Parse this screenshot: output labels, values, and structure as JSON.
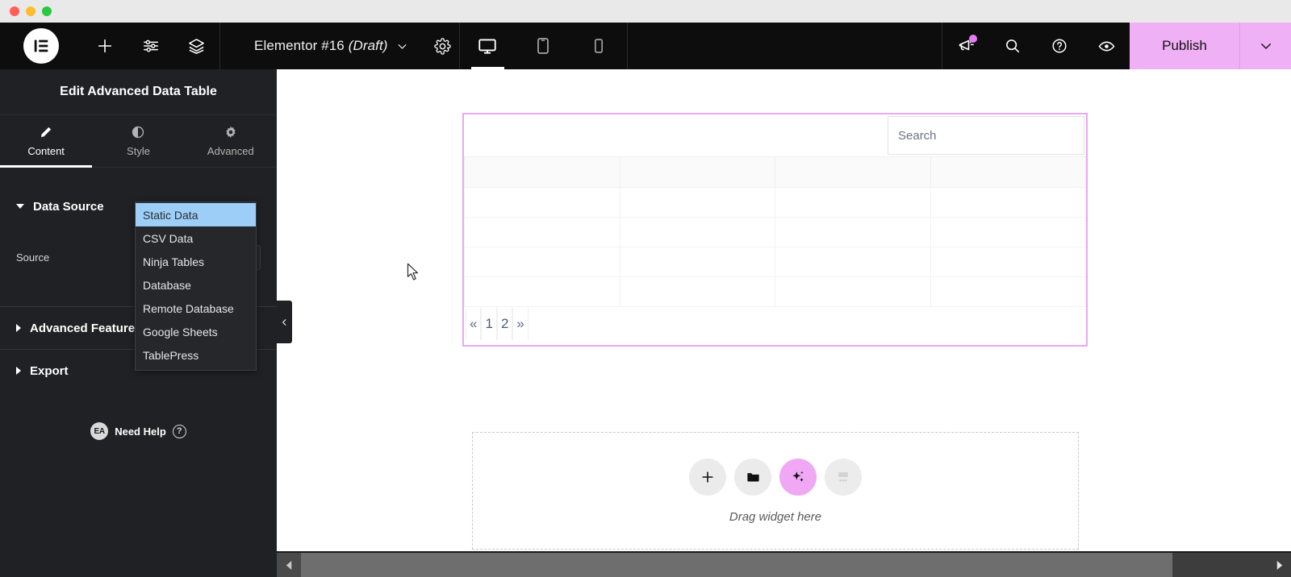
{
  "window": {
    "traffic_lights": [
      "close",
      "minimize",
      "zoom"
    ]
  },
  "topbar": {
    "logo_name": "elementor-logo",
    "add_label": "+",
    "icons": [
      "elementor-logo",
      "add-element-icon",
      "settings-sliders-icon",
      "layers-icon"
    ],
    "document_title": "Elementor #16",
    "document_state": "(Draft)",
    "settings_icon": "gear-icon",
    "devices": [
      {
        "name": "desktop",
        "label": "Desktop",
        "active": true
      },
      {
        "name": "tablet",
        "label": "Tablet",
        "active": false
      },
      {
        "name": "mobile",
        "label": "Mobile",
        "active": false
      }
    ],
    "right_icons": [
      {
        "name": "whats-new-megaphone-icon",
        "badge": true
      },
      {
        "name": "search-icon",
        "badge": false
      },
      {
        "name": "help-icon",
        "badge": false
      },
      {
        "name": "preview-eye-icon",
        "badge": false
      }
    ],
    "publish_label": "Publish",
    "publish_color": "#f0b0f5",
    "publish_caret_icon": "chevron-down-icon"
  },
  "panel": {
    "title": "Edit Advanced Data Table",
    "tabs": [
      {
        "label": "Content",
        "icon": "pencil-icon",
        "active": true
      },
      {
        "label": "Style",
        "icon": "contrast-circle-icon",
        "active": false
      },
      {
        "label": "Advanced",
        "icon": "gear-icon",
        "active": false
      }
    ],
    "sections": [
      {
        "label": "Data Source",
        "expanded": true
      },
      {
        "label": "Advanced Features",
        "expanded": false
      },
      {
        "label": "Export",
        "expanded": false
      }
    ],
    "source_control": {
      "label": "Source",
      "value": "Static Data",
      "options": [
        "Static Data",
        "CSV Data",
        "Ninja Tables",
        "Database",
        "Remote Database",
        "Google Sheets",
        "TablePress"
      ],
      "selected_index": 0
    },
    "need_help": {
      "badge": "EA",
      "label": "Need Help",
      "icon": "question-circle-icon"
    },
    "collapse_icon": "chevron-left-icon"
  },
  "canvas": {
    "table_widget": {
      "search_placeholder": "Search",
      "columns": 4,
      "header_row": [
        "",
        "",
        "",
        ""
      ],
      "rows": [
        [
          "",
          "",
          "",
          ""
        ],
        [
          "",
          "",
          "",
          ""
        ],
        [
          "",
          "",
          "",
          ""
        ],
        [
          "",
          "",
          "",
          ""
        ]
      ],
      "pagination": [
        "«",
        "1",
        "2",
        "»"
      ]
    },
    "dropzone": {
      "text": "Drag widget here",
      "buttons": [
        {
          "name": "add-element-button",
          "icon": "plus-icon"
        },
        {
          "name": "add-template-button",
          "icon": "folder-icon"
        },
        {
          "name": "ai-button",
          "icon": "sparkles-icon",
          "accent": "#f0a8f5"
        },
        {
          "name": "add-container-button",
          "icon": "containers-icon"
        }
      ]
    }
  },
  "scrollbar": {
    "left_arrow_icon": "triangle-left-icon",
    "right_arrow_icon": "triangle-right-icon"
  }
}
